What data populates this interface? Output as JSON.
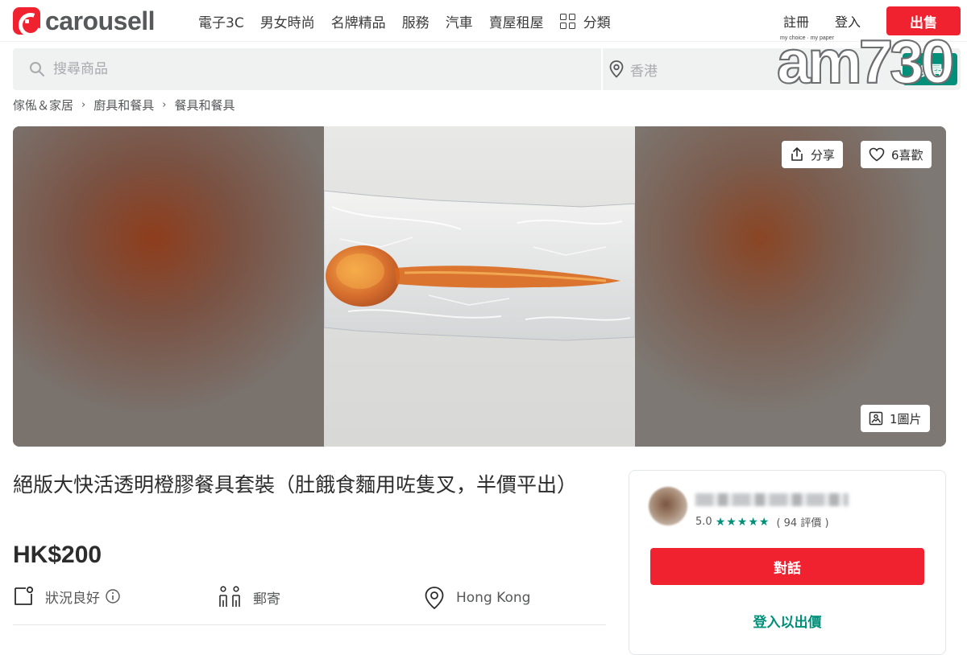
{
  "header": {
    "logo_text": "carousell",
    "nav": [
      "電子3C",
      "男女時尚",
      "名牌精品",
      "服務",
      "汽車",
      "賣屋租屋"
    ],
    "categories_label": "分類",
    "register_label": "註冊",
    "login_label": "登入",
    "sell_label": "出售"
  },
  "search": {
    "placeholder": "搜尋商品",
    "location": "香港",
    "button_label": "搜尋"
  },
  "watermark": {
    "tagline": "my choice · my paper",
    "text": "am730"
  },
  "breadcrumb": [
    "傢俬＆家居",
    "廚具和餐具",
    "餐具和餐具"
  ],
  "gallery": {
    "share_label": "分享",
    "like_label": "6喜歡",
    "photo_count_label": "1圖片"
  },
  "listing": {
    "title": "絕版大快活透明橙膠餐具套裝（肚餓食麵用咗隻叉，半價平出）",
    "price": "HK$200",
    "condition": "狀況良好",
    "delivery": "郵寄",
    "location": "Hong Kong"
  },
  "seller": {
    "rating": "5.0",
    "reviews": "( 94 評價 )",
    "chat_label": "對話",
    "offer_label": "登入以出價"
  },
  "colors": {
    "brand_red": "#f0222f",
    "brand_green": "#008f79"
  }
}
